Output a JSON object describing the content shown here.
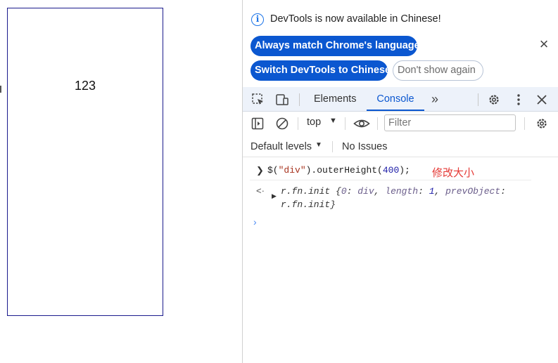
{
  "page": {
    "box_text": "123"
  },
  "infobar": {
    "message": "DevTools is now available in Chinese!",
    "buttons": {
      "match_language": "Always match Chrome's language",
      "switch_chinese": "Switch DevTools to Chinese",
      "dont_show": "Don't show again"
    },
    "close_glyph": "×"
  },
  "tabs": {
    "elements": "Elements",
    "console": "Console",
    "more": "»"
  },
  "console_toolbar": {
    "context": "top",
    "filter_placeholder": "Filter",
    "default_levels": "Default levels",
    "issues": "No Issues"
  },
  "console": {
    "input": {
      "prefix": "$(",
      "string": "\"div\"",
      "middle": ").outerHeight(",
      "number": "400",
      "suffix": ");"
    },
    "annotation": "修改大小",
    "output": {
      "prefix": "r.fn.init {",
      "k0": "0",
      "v0": "div",
      "k1": "length",
      "v1": "1",
      "k2": "prevObject",
      "v2": "r.fn.init",
      "suffix": "}"
    }
  },
  "icons": {
    "info": "info-icon",
    "inspect": "inspect-element-icon",
    "device": "device-toolbar-icon",
    "settings": "gear-icon",
    "more": "kebab-menu-icon",
    "close": "close-icon",
    "sidebar": "sidebar-toggle-icon",
    "clear": "clear-console-icon",
    "eye": "live-expression-icon"
  },
  "colors": {
    "accent": "#0b57d0",
    "tabbar_bg": "#edf2fa",
    "annotation": "#e53935",
    "box_border": "#1a1a8c"
  }
}
